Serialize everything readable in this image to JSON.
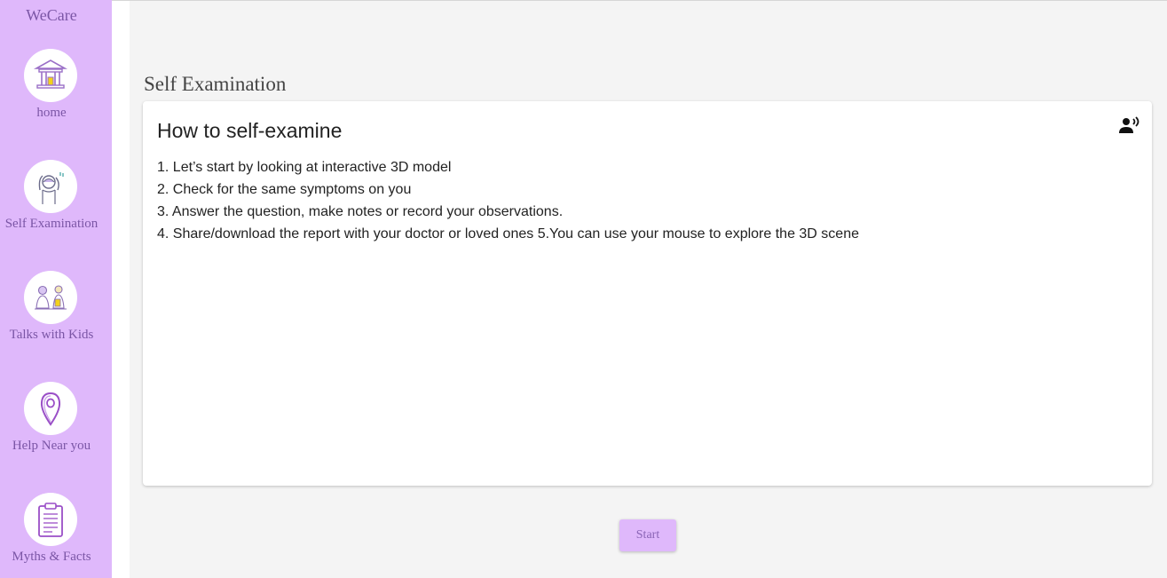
{
  "app": {
    "brand": "WeCare"
  },
  "sidebar": {
    "items": [
      {
        "label": "home",
        "icon": "home-icon"
      },
      {
        "label": "Self Examination",
        "icon": "self-exam-icon"
      },
      {
        "label": "Talks with Kids",
        "icon": "talks-kids-icon"
      },
      {
        "label": "Help Near you",
        "icon": "location-pin-icon"
      },
      {
        "label": "Myths & Facts",
        "icon": "clipboard-icon"
      }
    ]
  },
  "main": {
    "page_title": "Self Examination",
    "card": {
      "title": "How to self-examine",
      "steps": [
        "1. Let’s start by looking at interactive 3D model",
        "2. Check for the same symptoms on you",
        "3. Answer the question, make notes or record your observations.",
        "4. Share/download the report with your doctor or loved ones 5.You can use your mouse to explore the 3D scene"
      ],
      "speaker_icon": "text-to-speech-icon"
    },
    "start_label": "Start"
  },
  "colors": {
    "sidebar": "#dfb8fb",
    "accent_text": "#7b56a6",
    "main_bg": "#f4f4f4"
  }
}
